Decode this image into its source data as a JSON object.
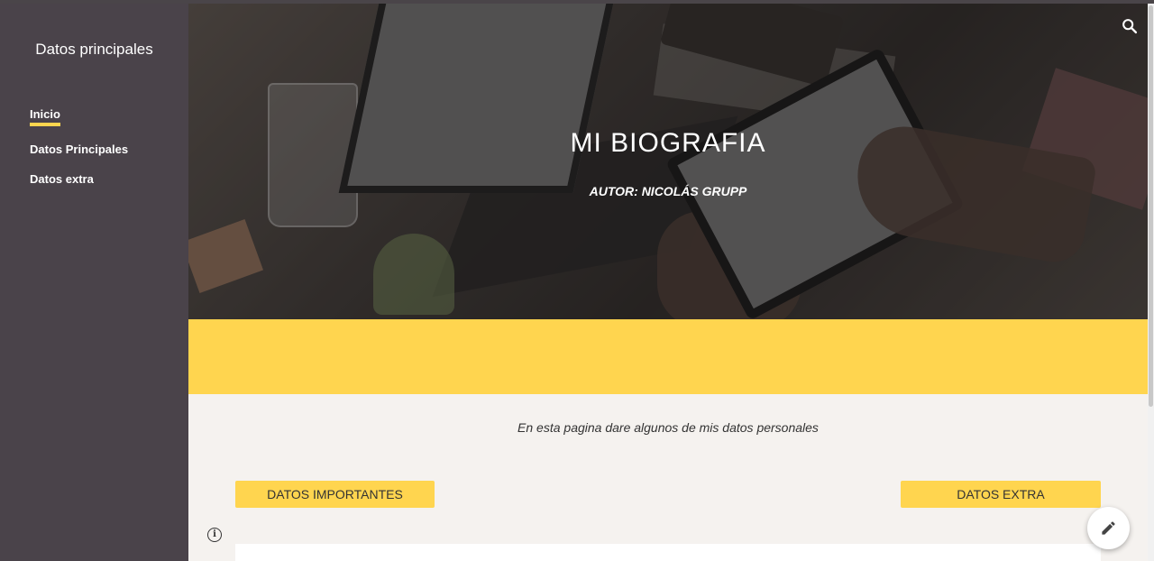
{
  "sidebar": {
    "title": "Datos principales",
    "items": [
      {
        "label": "Inicio",
        "active": true
      },
      {
        "label": "Datos Principales",
        "active": false
      },
      {
        "label": "Datos extra",
        "active": false
      }
    ]
  },
  "hero": {
    "title": "MI BIOGRAFIA",
    "author": "AUTOR: NICOLÁS GRUPP"
  },
  "content": {
    "intro": "En esta pagina dare algunos de mis datos personales",
    "buttons": {
      "important": "DATOS IMPORTANTES",
      "extra": "DATOS EXTRA"
    }
  },
  "icons": {
    "search": "search-icon",
    "info": "info-icon",
    "edit": "pencil-icon"
  },
  "colors": {
    "sidebar_bg": "#4a434a",
    "accent": "#ffd54f",
    "page_bg": "#f5f2ef"
  }
}
